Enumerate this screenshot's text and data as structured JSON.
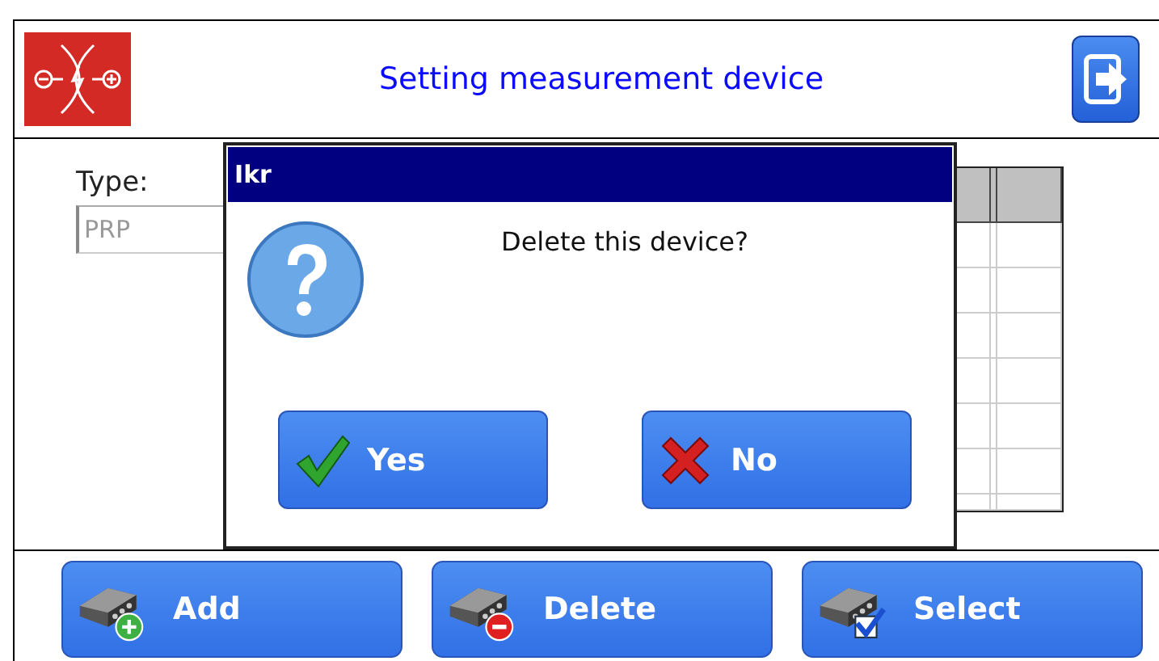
{
  "header": {
    "title": "Setting measurement device"
  },
  "form": {
    "type_label": "Type:",
    "type_value": "PRP"
  },
  "dialog": {
    "title": "Ikr",
    "message": "Delete this device?",
    "buttons": [
      {
        "label": "Yes",
        "kind": "yes"
      },
      {
        "label": "No",
        "kind": "no"
      }
    ]
  },
  "toolbar": [
    {
      "label": "Add",
      "kind": "add"
    },
    {
      "label": "Delete",
      "kind": "delete"
    },
    {
      "label": "Select",
      "kind": "select"
    }
  ]
}
